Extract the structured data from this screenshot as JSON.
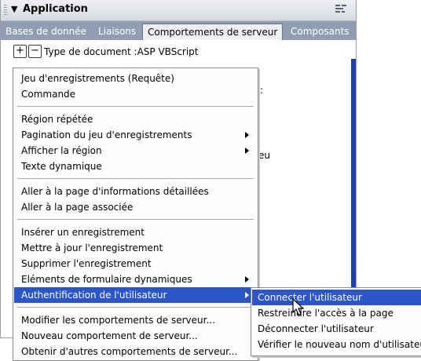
{
  "panel": {
    "title": "Application",
    "tabs": [
      "Bases de donnée",
      "Liaisons",
      "Comportements de serveur",
      "Composants"
    ],
    "active_tab": 2,
    "toolbar": {
      "add_label": "+",
      "remove_label": "−",
      "document_type": "Type de document :ASP VBScript"
    },
    "behind_fragments": [
      ":",
      "eu"
    ]
  },
  "menu": {
    "items": [
      {
        "label": "Jeu d'enregistrements (Requête)"
      },
      {
        "label": "Commande"
      },
      {
        "label": "Région répétée"
      },
      {
        "label": "Pagination du jeu d'enregistrements",
        "submenu": true
      },
      {
        "label": "Afficher la région",
        "submenu": true
      },
      {
        "label": "Texte dynamique"
      },
      {
        "label": "Aller à la page d'informations détaillées"
      },
      {
        "label": "Aller à la page associée"
      },
      {
        "label": "Insérer un enregistrement"
      },
      {
        "label": "Mettre à jour l'enregistrement"
      },
      {
        "label": "Supprimer l'enregistrement"
      },
      {
        "label": "Eléments de formulaire dynamiques",
        "submenu": true
      },
      {
        "label": "Authentification de l'utilisateur",
        "submenu": true,
        "active": true
      },
      {
        "label": "Modifier les comportements de serveur..."
      },
      {
        "label": "Nouveau comportement de serveur..."
      },
      {
        "label": "Obtenir d'autres comportements de serveur..."
      }
    ]
  },
  "submenu": {
    "items": [
      {
        "label": "Connecter l'utilisateur",
        "active": true
      },
      {
        "label": "Restreindre l'accès à la page"
      },
      {
        "label": "Déconnecter l'utilisateur"
      },
      {
        "label": "Vérifier le nouveau nom d'utilisateur"
      }
    ]
  },
  "colors": {
    "highlight": "#2a56c7",
    "tab_bar": "#8f9eb3",
    "scroll_strip": "#1d3fb3"
  }
}
